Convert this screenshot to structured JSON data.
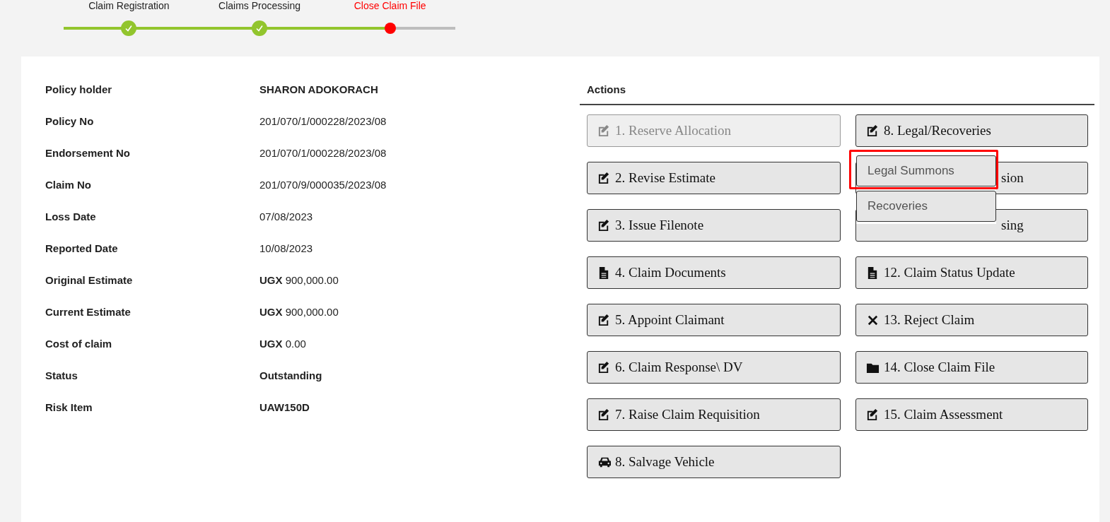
{
  "stepper": [
    {
      "label": "Claim Registration",
      "completed": true
    },
    {
      "label": "Claims Processing",
      "completed": true
    },
    {
      "label": "Close Claim File",
      "completed": false
    }
  ],
  "details": [
    {
      "label": "Policy holder",
      "value": "SHARON ADOKORACH",
      "bold": true
    },
    {
      "label": "Policy No",
      "value": "201/070/1/000228/2023/08",
      "bold": false
    },
    {
      "label": "Endorsement No",
      "value": "201/070/1/000228/2023/08",
      "bold": false
    },
    {
      "label": "Claim No",
      "value": "201/070/9/000035/2023/08",
      "bold": false
    },
    {
      "label": "Loss Date",
      "value": "07/08/2023",
      "bold": false
    },
    {
      "label": "Reported Date",
      "value": "10/08/2023",
      "bold": false
    },
    {
      "label": "Original Estimate",
      "value": "**UGX** 900,000.00",
      "bold": false
    },
    {
      "label": "Current Estimate",
      "value": "**UGX** 900,000.00",
      "bold": false
    },
    {
      "label": "Cost of claim",
      "value": "**UGX** 0.00",
      "bold": false
    },
    {
      "label": "Status",
      "value": "Outstanding",
      "bold": true
    },
    {
      "label": "Risk Item",
      "value": "UAW150D",
      "bold": true
    }
  ],
  "actions": {
    "title": "Actions",
    "left": [
      {
        "kind": "edit",
        "label": "1. Reserve Allocation",
        "disabled": true
      },
      {
        "kind": "edit",
        "label": "2. Revise Estimate",
        "disabled": false
      },
      {
        "kind": "edit",
        "label": "3. Issue Filenote",
        "disabled": false
      },
      {
        "kind": "file",
        "label": "4. Claim Documents",
        "disabled": false
      },
      {
        "kind": "edit",
        "label": "5. Appoint Claimant",
        "disabled": false
      },
      {
        "kind": "edit",
        "label": "6. Claim Response\\ DV",
        "disabled": false
      },
      {
        "kind": "edit",
        "label": "7. Raise Claim Requisition",
        "disabled": false
      },
      {
        "kind": "car",
        "label": "8. Salvage Vehicle",
        "disabled": false
      }
    ],
    "right": [
      {
        "kind": "edit",
        "label": "8. Legal/Recoveries",
        "disabled": false
      },
      {
        "kind": "covered",
        "label": "sion",
        "disabled": false
      },
      {
        "kind": "covered",
        "label": "sing",
        "disabled": false
      },
      {
        "kind": "file",
        "label": "12. Claim Status Update",
        "disabled": false
      },
      {
        "kind": "times",
        "label": "13. Reject Claim",
        "disabled": false
      },
      {
        "kind": "folder",
        "label": "14. Close Claim File",
        "disabled": false
      },
      {
        "kind": "edit",
        "label": "15. Claim Assessment",
        "disabled": false
      }
    ],
    "dropdown": [
      {
        "label": "Legal Summons",
        "highlighted": true
      },
      {
        "label": "Recoveries",
        "highlighted": false
      }
    ]
  }
}
